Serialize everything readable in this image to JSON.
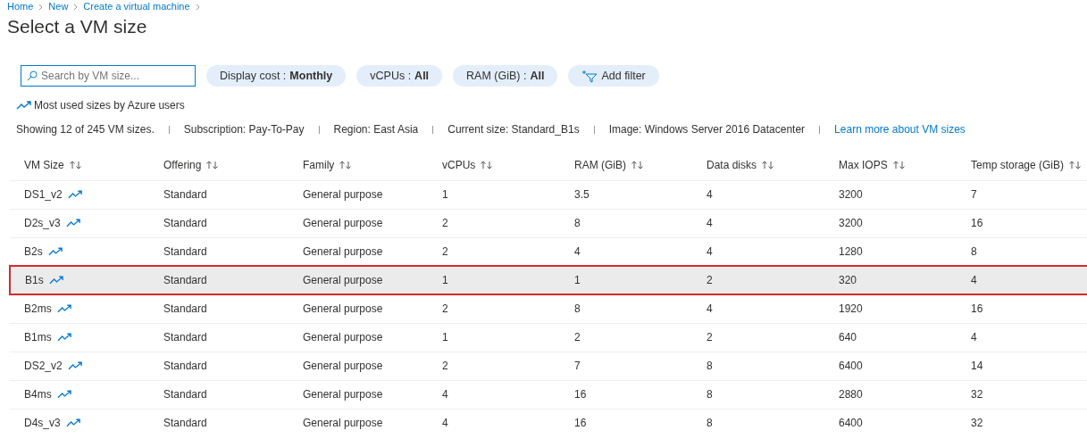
{
  "breadcrumb": [
    "Home",
    "New",
    "Create a virtual machine"
  ],
  "title": "Select a VM size",
  "search": {
    "placeholder": "Search by VM size..."
  },
  "filters": [
    {
      "label": "Display cost : ",
      "value": "Monthly"
    },
    {
      "label": "vCPUs : ",
      "value": "All"
    },
    {
      "label": "RAM (GiB) : ",
      "value": "All"
    }
  ],
  "add_filter": "Add filter",
  "most_used": "Most used sizes by Azure users",
  "info": [
    "Showing 12 of 245 VM sizes.",
    "Subscription: Pay-To-Pay",
    "Region: East Asia",
    "Current size: Standard_B1s",
    "Image: Windows Server 2016 Datacenter"
  ],
  "learn_more": "Learn more about VM sizes",
  "table": {
    "columns": [
      "VM Size",
      "Offering",
      "Family",
      "vCPUs",
      "RAM (GiB)",
      "Data disks",
      "Max IOPS",
      "Temp storage (GiB)"
    ],
    "rows": [
      {
        "selected": false,
        "cells": [
          "DS1_v2",
          "Standard",
          "General purpose",
          "1",
          "3.5",
          "4",
          "3200",
          "7"
        ]
      },
      {
        "selected": false,
        "cells": [
          "D2s_v3",
          "Standard",
          "General purpose",
          "2",
          "8",
          "4",
          "3200",
          "16"
        ]
      },
      {
        "selected": false,
        "cells": [
          "B2s",
          "Standard",
          "General purpose",
          "2",
          "4",
          "4",
          "1280",
          "8"
        ]
      },
      {
        "selected": true,
        "cells": [
          "B1s",
          "Standard",
          "General purpose",
          "1",
          "1",
          "2",
          "320",
          "4"
        ]
      },
      {
        "selected": false,
        "cells": [
          "B2ms",
          "Standard",
          "General purpose",
          "2",
          "8",
          "4",
          "1920",
          "16"
        ]
      },
      {
        "selected": false,
        "cells": [
          "B1ms",
          "Standard",
          "General purpose",
          "1",
          "2",
          "2",
          "640",
          "4"
        ]
      },
      {
        "selected": false,
        "cells": [
          "DS2_v2",
          "Standard",
          "General purpose",
          "2",
          "7",
          "8",
          "6400",
          "14"
        ]
      },
      {
        "selected": false,
        "cells": [
          "B4ms",
          "Standard",
          "General purpose",
          "4",
          "16",
          "8",
          "2880",
          "32"
        ]
      },
      {
        "selected": false,
        "cells": [
          "D4s_v3",
          "Standard",
          "General purpose",
          "4",
          "16",
          "8",
          "6400",
          "32"
        ]
      }
    ]
  }
}
